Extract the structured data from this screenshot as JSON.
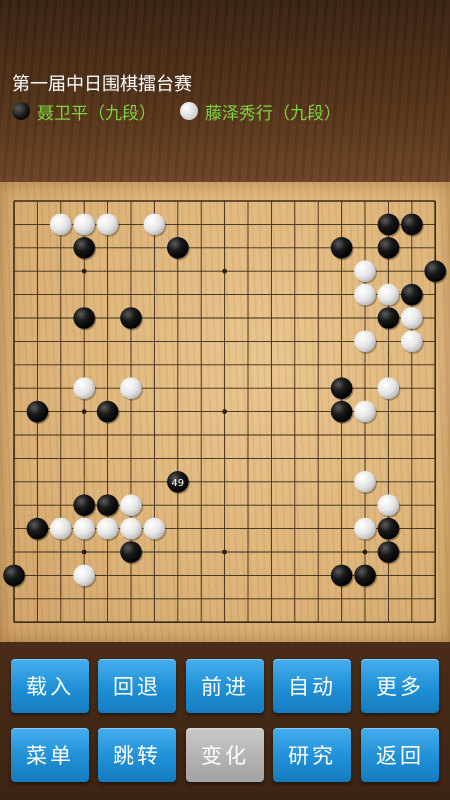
{
  "header": {
    "title": "第一届中日围棋擂台赛",
    "black_player": {
      "name": "聂卫平",
      "rank": "（九段）"
    },
    "white_player": {
      "name": "藤泽秀行",
      "rank": "（九段）"
    }
  },
  "board": {
    "size": 19,
    "last_move": {
      "col": 7,
      "row": 12,
      "number": "49"
    },
    "black_stones": [
      [
        3,
        2
      ],
      [
        7,
        2
      ],
      [
        3,
        5
      ],
      [
        5,
        5
      ],
      [
        1,
        9
      ],
      [
        4,
        9
      ],
      [
        3,
        13
      ],
      [
        4,
        13
      ],
      [
        5,
        15
      ],
      [
        1,
        14
      ],
      [
        0,
        16
      ],
      [
        14,
        16
      ],
      [
        15,
        16
      ],
      [
        14,
        2
      ],
      [
        16,
        1
      ],
      [
        17,
        1
      ],
      [
        16,
        2
      ],
      [
        18,
        3
      ],
      [
        17,
        4
      ],
      [
        16,
        5
      ],
      [
        14,
        8
      ],
      [
        14,
        9
      ],
      [
        16,
        14
      ],
      [
        16,
        15
      ],
      [
        7,
        12
      ]
    ],
    "white_stones": [
      [
        2,
        1
      ],
      [
        3,
        1
      ],
      [
        4,
        1
      ],
      [
        6,
        1
      ],
      [
        3,
        8
      ],
      [
        5,
        8
      ],
      [
        2,
        14
      ],
      [
        3,
        14
      ],
      [
        4,
        14
      ],
      [
        5,
        14
      ],
      [
        6,
        14
      ],
      [
        5,
        13
      ],
      [
        3,
        16
      ],
      [
        15,
        3
      ],
      [
        15,
        4
      ],
      [
        16,
        4
      ],
      [
        17,
        5
      ],
      [
        15,
        6
      ],
      [
        17,
        6
      ],
      [
        16,
        8
      ],
      [
        15,
        9
      ],
      [
        15,
        12
      ],
      [
        16,
        13
      ],
      [
        15,
        14
      ]
    ],
    "star_points": [
      [
        3,
        3
      ],
      [
        9,
        3
      ],
      [
        15,
        3
      ],
      [
        3,
        9
      ],
      [
        9,
        9
      ],
      [
        15,
        9
      ],
      [
        3,
        15
      ],
      [
        9,
        15
      ],
      [
        15,
        15
      ]
    ]
  },
  "toolbar": {
    "row1": [
      "载入",
      "回退",
      "前进",
      "自动",
      "更多"
    ],
    "row2": [
      "菜单",
      "跳转",
      "变化",
      "研究",
      "返回"
    ]
  },
  "colors": {
    "button_blue": "#1f8fd6",
    "button_gray": "#b3b3b3",
    "name_green": "#7dd43f"
  }
}
